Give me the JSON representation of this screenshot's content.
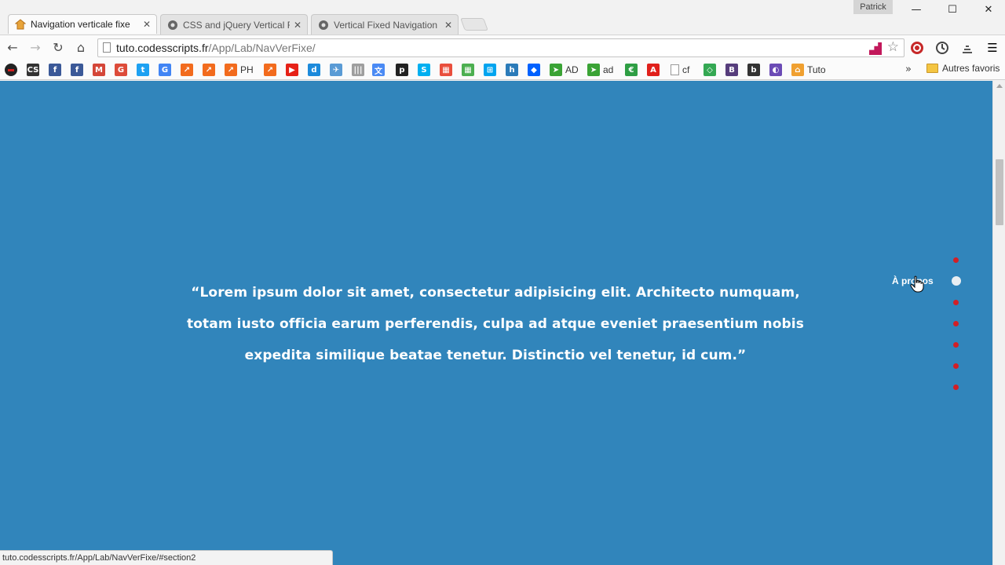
{
  "browser": {
    "profile": "Patrick",
    "tabs": [
      {
        "title": "Navigation verticale fixe",
        "active": true
      },
      {
        "title": "CSS and jQuery Vertical Fi",
        "active": false
      },
      {
        "title": "Vertical Fixed Navigation",
        "active": false
      }
    ],
    "window_controls": {
      "minimize": "—",
      "maximize": "☐",
      "close": "✕"
    },
    "address_bar": {
      "host": "tuto.codesscripts.fr",
      "path": "/App/Lab/NavVerFixe/"
    },
    "bookmarks": [
      {
        "icon": "dark-circle-icon",
        "label": "",
        "color": "#d11e1e"
      },
      {
        "icon": "cs-icon",
        "label": "",
        "glyph": "CS",
        "color": "#333333"
      },
      {
        "icon": "facebook-icon",
        "label": "",
        "glyph": "f",
        "color": "#3b5998"
      },
      {
        "icon": "facebook-icon",
        "label": "",
        "glyph": "f",
        "color": "#3b5998"
      },
      {
        "icon": "gmail-icon",
        "label": "",
        "glyph": "M",
        "color": "#d44638"
      },
      {
        "icon": "google-plus-icon",
        "label": "",
        "glyph": "G",
        "color": "#dd4b39"
      },
      {
        "icon": "twitter-icon",
        "label": "",
        "glyph": "t",
        "color": "#1da1f2"
      },
      {
        "icon": "google-icon",
        "label": "",
        "glyph": "G",
        "color": "#4285f4"
      },
      {
        "icon": "trend-icon",
        "label": "",
        "glyph": "↗",
        "color": "#f26b1d"
      },
      {
        "icon": "trend-icon",
        "label": "",
        "glyph": "↗",
        "color": "#f26b1d"
      },
      {
        "icon": "trend-icon",
        "label": "PH",
        "glyph": "↗",
        "color": "#f26b1d"
      },
      {
        "icon": "trend-icon",
        "label": "",
        "glyph": "↗",
        "color": "#f26b1d"
      },
      {
        "icon": "youtube-icon",
        "label": "",
        "glyph": "▶",
        "color": "#e62117"
      },
      {
        "icon": "d-icon",
        "label": "",
        "glyph": "d",
        "color": "#1c8adb"
      },
      {
        "icon": "plane-icon",
        "label": "",
        "glyph": "✈",
        "color": "#5a9bd5"
      },
      {
        "icon": "bars-icon",
        "label": "",
        "glyph": "|||",
        "color": "#9e9e9e"
      },
      {
        "icon": "translate-icon",
        "label": "",
        "glyph": "文",
        "color": "#4a8af4"
      },
      {
        "icon": "p-icon",
        "label": "",
        "glyph": "p",
        "color": "#222222"
      },
      {
        "icon": "skype-icon",
        "label": "",
        "glyph": "S",
        "color": "#00aff0"
      },
      {
        "icon": "grid-icon",
        "label": "",
        "glyph": "▦",
        "color": "#e94e3c"
      },
      {
        "icon": "grid-icon",
        "label": "",
        "glyph": "▦",
        "color": "#4caf50"
      },
      {
        "icon": "windows-icon",
        "label": "",
        "glyph": "⊞",
        "color": "#00a4ef"
      },
      {
        "icon": "h-icon",
        "label": "",
        "glyph": "h",
        "color": "#2b7bb9"
      },
      {
        "icon": "dropbox-icon",
        "label": "",
        "glyph": "◆",
        "color": "#0061fe"
      },
      {
        "icon": "arrow-icon",
        "label": "AD",
        "glyph": "➤",
        "color": "#3aa335"
      },
      {
        "icon": "arrow-icon",
        "label": "ad",
        "glyph": "➤",
        "color": "#3aa335"
      },
      {
        "icon": "euro-icon",
        "label": "",
        "glyph": "€",
        "color": "#2e9e44"
      },
      {
        "icon": "adobe-icon",
        "label": "",
        "glyph": "A",
        "color": "#e0201b"
      },
      {
        "icon": "page-icon",
        "label": "cf",
        "glyph": "",
        "color": "#ffffff"
      },
      {
        "icon": "diamond-icon",
        "label": "",
        "glyph": "◇",
        "color": "#34a853"
      },
      {
        "icon": "bootstrap-icon",
        "label": "",
        "glyph": "B",
        "color": "#563d7c"
      },
      {
        "icon": "b-icon",
        "label": "",
        "glyph": "b",
        "color": "#333333"
      },
      {
        "icon": "circle-icon",
        "label": "",
        "glyph": "◐",
        "color": "#6b4bb5"
      },
      {
        "icon": "tuto-icon",
        "label": "Tuto",
        "glyph": "⌂",
        "color": "#f0a030"
      }
    ],
    "bookmarks_overflow": "»",
    "other_bookmarks": "Autres favoris",
    "status_url": "tuto.codesscripts.fr/App/Lab/NavVerFixe/#section2"
  },
  "page": {
    "background": "#3185bb",
    "quote": "“Lorem ipsum dolor sit amet, consectetur adipisicing elit. Architecto numquam, totam iusto officia earum perferendis, culpa ad atque eveniet praesentium nobis expedita similique beatae tenetur. Distinctio vel tenetur, id cum.”",
    "dot_nav": {
      "hover_label": "À propos",
      "dots": [
        {
          "id": "section1",
          "active": false
        },
        {
          "id": "section2",
          "active": true
        },
        {
          "id": "section3",
          "active": false
        },
        {
          "id": "section4",
          "active": false
        },
        {
          "id": "section5",
          "active": false
        },
        {
          "id": "section6",
          "active": false
        },
        {
          "id": "section7",
          "active": false
        }
      ],
      "dot_color": "#d21f26"
    }
  }
}
